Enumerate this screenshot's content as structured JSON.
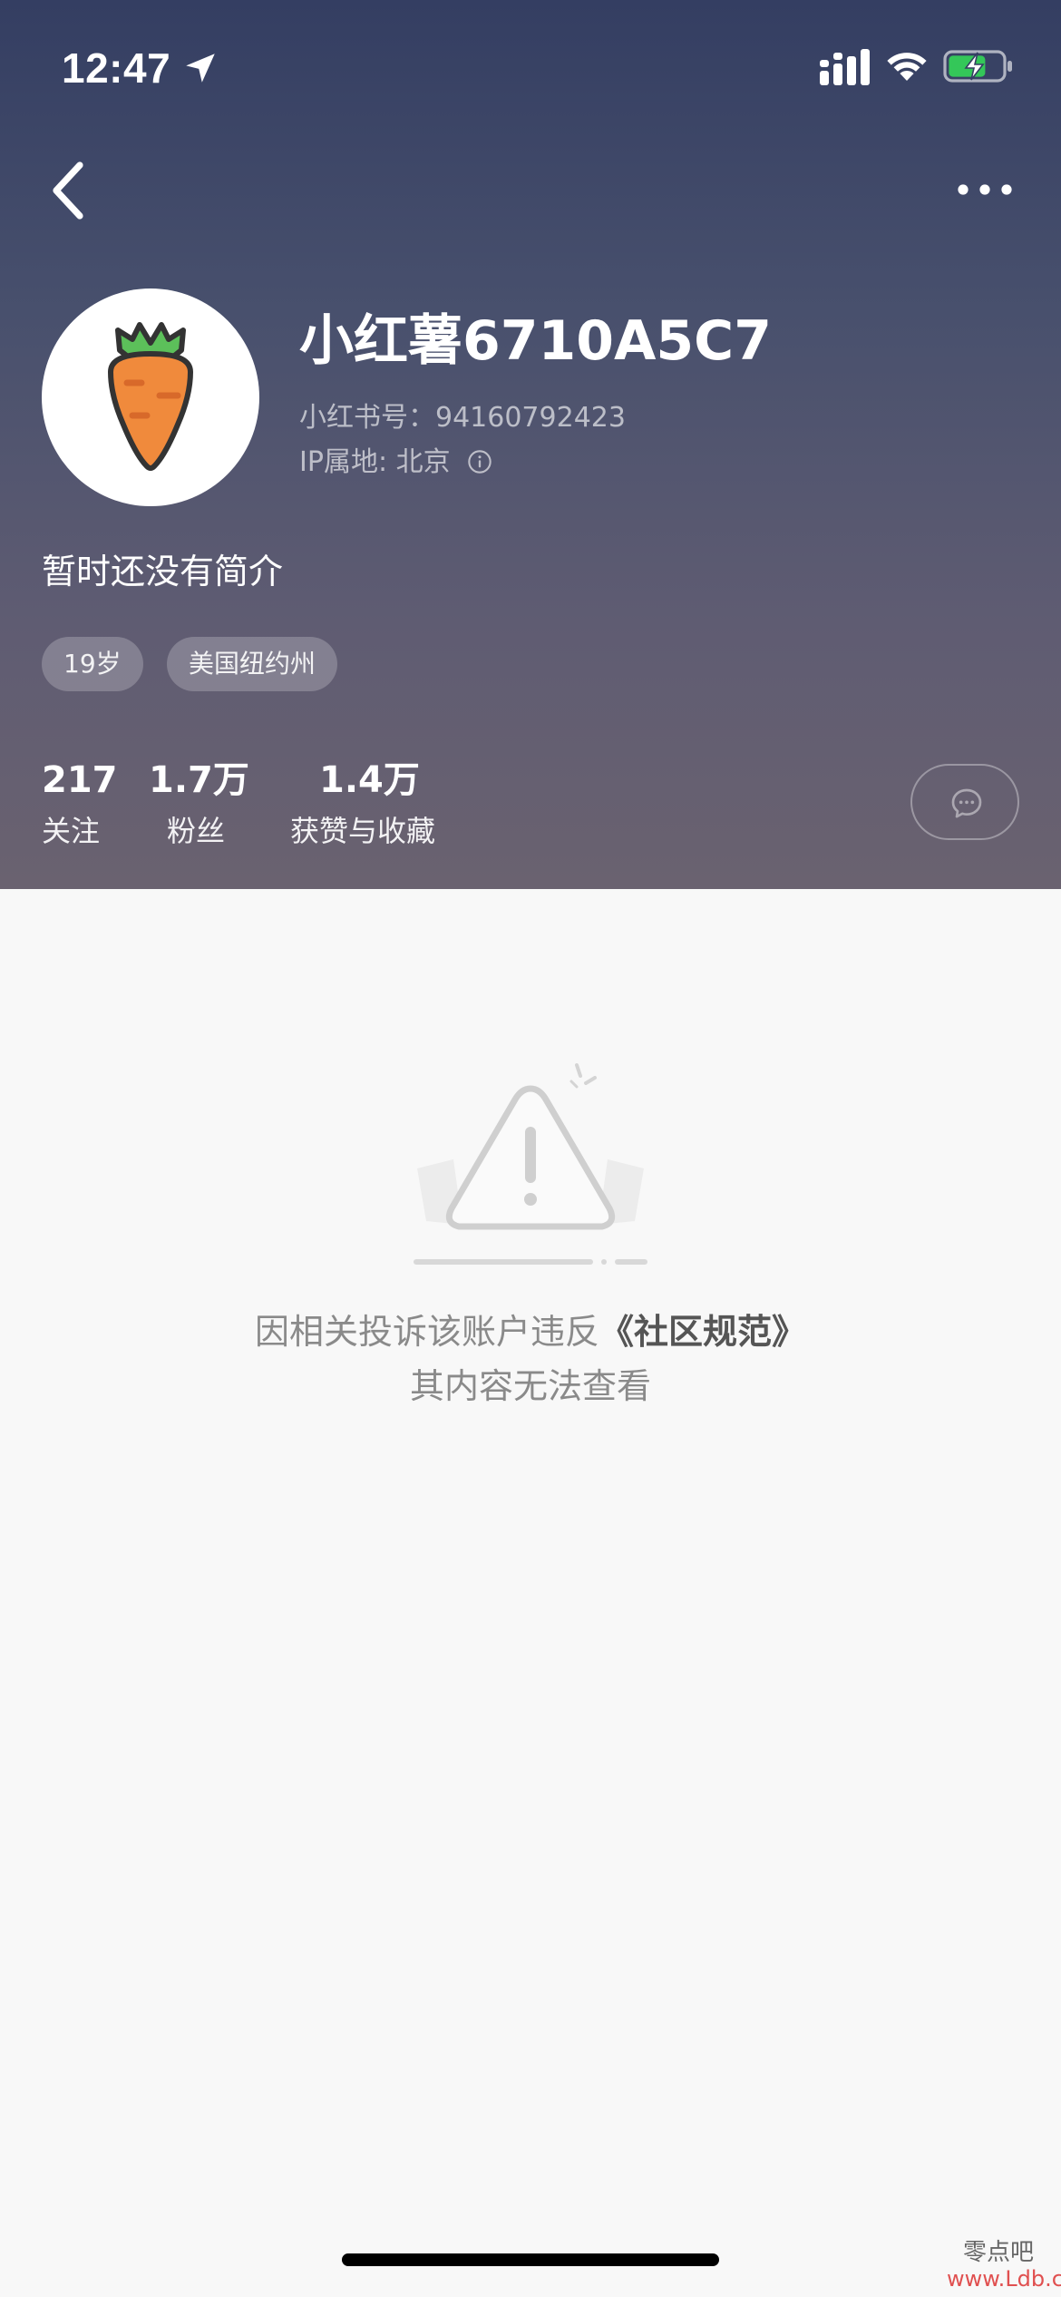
{
  "status_bar": {
    "time": "12:47",
    "icons": [
      "location-arrow-icon",
      "cellular-signal-icon",
      "wifi-icon",
      "battery-charging-icon"
    ],
    "battery_color": "#34c759"
  },
  "nav": {
    "back_icon": "chevron-left-icon",
    "more_icon": "more-dots-icon"
  },
  "profile": {
    "avatar_icon": "carrot-avatar-icon",
    "username": "小红薯6710A5C7",
    "user_id": "小红书号：94160792423",
    "ip_location": "IP属地: 北京",
    "bio": "暂时还没有简介",
    "tags": [
      "19岁",
      "美国纽约州"
    ]
  },
  "stats": [
    {
      "value": "217",
      "label": "关注"
    },
    {
      "value": "1.7万",
      "label": "粉丝"
    },
    {
      "value": "1.4万",
      "label": "获赞与收藏"
    }
  ],
  "notice": {
    "line1_prefix": "因相关投诉该账户违反",
    "line1_link": "《社区规范》",
    "line2": "其内容无法查看",
    "illustration_icon": "warning-triangle-icon"
  },
  "watermark": {
    "line1": "零点吧",
    "line2": "www.Ldb.cc"
  },
  "colors": {
    "header_top": "#343e62",
    "header_bottom": "#6a6270",
    "avatar_carrot": "#f08a3c",
    "avatar_leaf": "#5cc05a",
    "content_bg": "#f8f8f8"
  }
}
